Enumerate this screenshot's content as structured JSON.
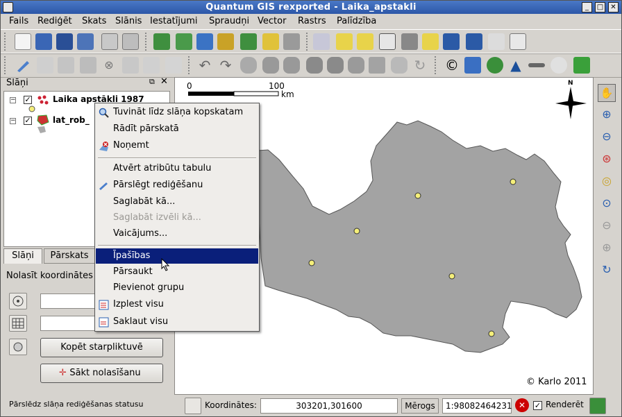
{
  "window": {
    "title": "Quantum GIS rexported - Laika_apstakli"
  },
  "menu": [
    "Fails",
    "Rediģēt",
    "Skats",
    "Slānis",
    "Iestatījumi",
    "Spraudņi",
    "Vector",
    "Rastrs",
    "Palīdzība"
  ],
  "layers_panel": {
    "title": "Slāņi",
    "layers": [
      {
        "name": "Laika apstākli 1987",
        "checked": true
      },
      {
        "name": "lat_rob_",
        "checked": true
      }
    ],
    "tabs": [
      "Slāņi",
      "Pārskats"
    ]
  },
  "coord_panel": {
    "title": "Nolasīt koordinātes",
    "copy_button": "Kopēt starpliktuvē",
    "start_button": "Sākt nolasīšanu"
  },
  "context_menu": {
    "items": [
      {
        "label": "Tuvināt līdz slāņa kopskatam",
        "icon": "zoom-to-layer-icon"
      },
      {
        "label": "Rādīt pārskatā",
        "icon": ""
      },
      {
        "label": "Noņemt",
        "icon": "remove-layer-icon"
      },
      {
        "label": "Atvērt atribūtu tabulu",
        "icon": ""
      },
      {
        "label": "Pārslēgt rediģēšanu",
        "icon": "pencil-icon"
      },
      {
        "label": "Saglabāt kā...",
        "icon": ""
      },
      {
        "label": "Saglabāt izvēli kā...",
        "icon": "",
        "disabled": true
      },
      {
        "label": "Vaicājums...",
        "icon": ""
      },
      {
        "label": "Īpašības",
        "icon": "",
        "selected": true
      },
      {
        "label": "Pārsaukt",
        "icon": ""
      },
      {
        "label": "Pievienot grupu",
        "icon": ""
      },
      {
        "label": "Izplest visu",
        "icon": "expand-all-icon"
      },
      {
        "label": "Saklaut visu",
        "icon": "collapse-all-icon"
      }
    ]
  },
  "map": {
    "scale_start": "0",
    "scale_end": "100",
    "scale_unit": "km",
    "north_label": "N",
    "copyright": "© Karlo 2011",
    "fill_color": "#a3a3a3",
    "point_color": "#f5ef7a"
  },
  "status": {
    "message": "Pārslēdz slāņa rediģēšanas statusu",
    "coord_label": "Koordinātes:",
    "coord_value": "303201,301600",
    "scale_label": "Mērogs",
    "scale_value": "1:98082464231",
    "render_label": "Renderēt"
  }
}
